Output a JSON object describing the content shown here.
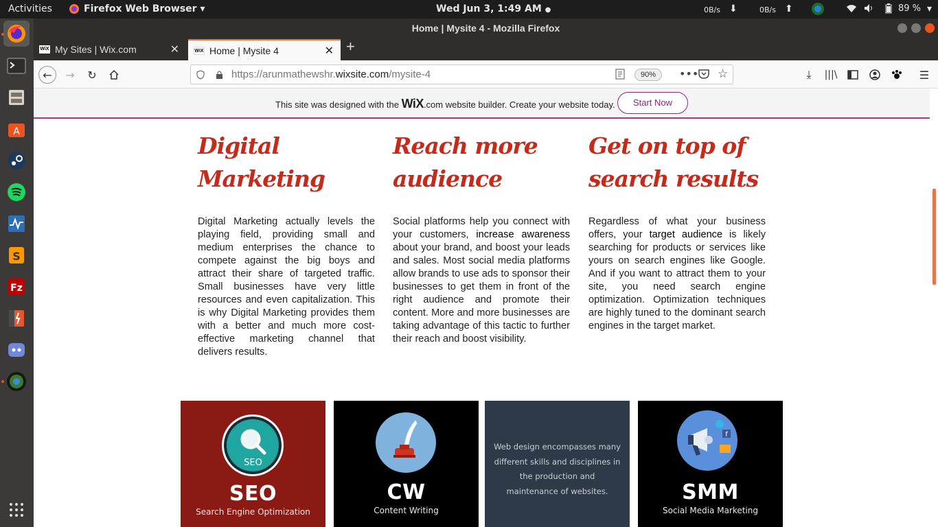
{
  "system": {
    "activities": "Activities",
    "app_menu": "Firefox Web Browser",
    "clock": "Wed Jun  3,  1:49 AM",
    "net_down": "0B/s",
    "net_up": "0B/s",
    "battery": "89 %"
  },
  "window": {
    "title": "Home | Mysite 4 - Mozilla Firefox"
  },
  "tabs": [
    {
      "label": "My Sites | Wix.com",
      "favicon": "WiX",
      "active": false
    },
    {
      "label": "Home | Mysite 4",
      "favicon": "WiX",
      "active": true
    }
  ],
  "navbar": {
    "url_prefix": "https://arunmathewshr.",
    "url_domain": "wixsite.com",
    "url_path": "/mysite-4",
    "zoom": "90%"
  },
  "wix_banner": {
    "text_before": "This site was designed with the",
    "logo": "WiX",
    "logo_suffix": ".com",
    "text_after": "website builder. Create your website today.",
    "button": "Start Now"
  },
  "columns": [
    {
      "title_line1": "Digital",
      "title_line2": "Marketing",
      "body_parts": [
        "Digital Marketing actually levels the playing field, providing small and medium enterprises the chance to compete against the big boys and attract their share of targeted traffic. Small businesses have very little resources and even capitalization. This is why Digital Marketing provides them with a better and much more cost-effective marketing channel that delivers results.",
        "",
        ""
      ]
    },
    {
      "title_line1": "Reach more",
      "title_line2": "audience",
      "body_parts": [
        "Social platforms help you connect with your customers, ",
        "increase awareness",
        " about your brand, and boost your leads and sales. Most social media platforms allow brands to use ads to sponsor their businesses to get them in front of the right audience and promote their content. More and more businesses are taking advantage of this tactic to further their reach and boost visibility."
      ]
    },
    {
      "title_line1": "Get on top of",
      "title_line2": "search results",
      "body_parts": [
        "Regardless of what your business offers, your ",
        "target audience",
        " is likely searching for products or services like yours on search engines like Google. And if you want to attract them to your site, you need search engine optimization. Optimization techniques are highly tuned to the dominant search engines in the target market."
      ]
    }
  ],
  "cards": [
    {
      "title": "SEO",
      "subtitle": "Search Engine Optimization",
      "icon_text": "SEO",
      "bg": "#8b1a14"
    },
    {
      "title": "CW",
      "subtitle": "Content Writing",
      "bg": "#000000"
    },
    {
      "text": "Web design encompasses many different skills and disciplines in the production and maintenance of websites.",
      "bg": "#2e3a48"
    },
    {
      "title": "SMM",
      "subtitle": "Social Media Marketing",
      "bg": "#000000"
    }
  ],
  "colors": {
    "heading": "#c62a1a",
    "wix_accent": "#8d2286",
    "firefox_accent": "#e87548"
  }
}
